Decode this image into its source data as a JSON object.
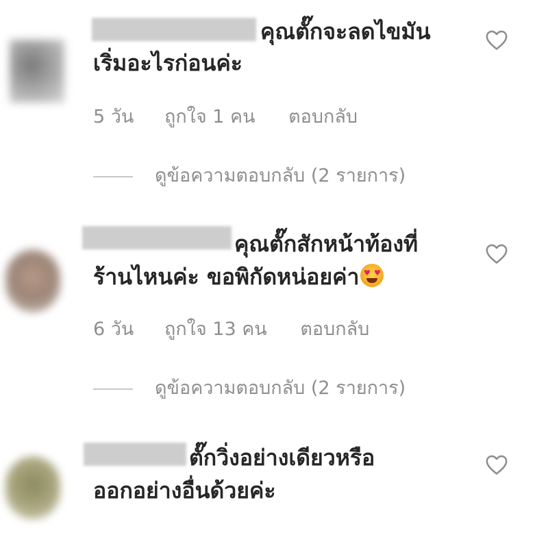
{
  "comments": [
    {
      "text_line1": "คุณตั๊กจะลดไขมัน",
      "text_line2": "เริ่มอะไรก่อนค่ะ",
      "time": "5 วัน",
      "likes": "ถูกใจ 1 คน",
      "reply": "ตอบกลับ",
      "view_replies": "ดูข้อความตอบกลับ (2 รายการ)"
    },
    {
      "text_line1": "คุณตั๊กสักหน้าท้องที่",
      "text_line2": "ร้านไหนค่ะ ขอพิกัดหน่อยค่า",
      "time": "6 วัน",
      "likes": "ถูกใจ 13 คน",
      "reply": "ตอบกลับ",
      "view_replies": "ดูข้อความตอบกลับ (2 รายการ)"
    },
    {
      "text_line1": "ตั๊กวิ่งอย่างเดียวหรือ",
      "text_line2": "ออกอย่างอื่นด้วยค่ะ"
    }
  ],
  "icons": {
    "like": "heart-outline-icon",
    "emoji": "smiling-face-with-heart-eyes"
  },
  "colors": {
    "text": "#262626",
    "meta": "#8e8e8e",
    "divider": "#c7c7c7"
  }
}
